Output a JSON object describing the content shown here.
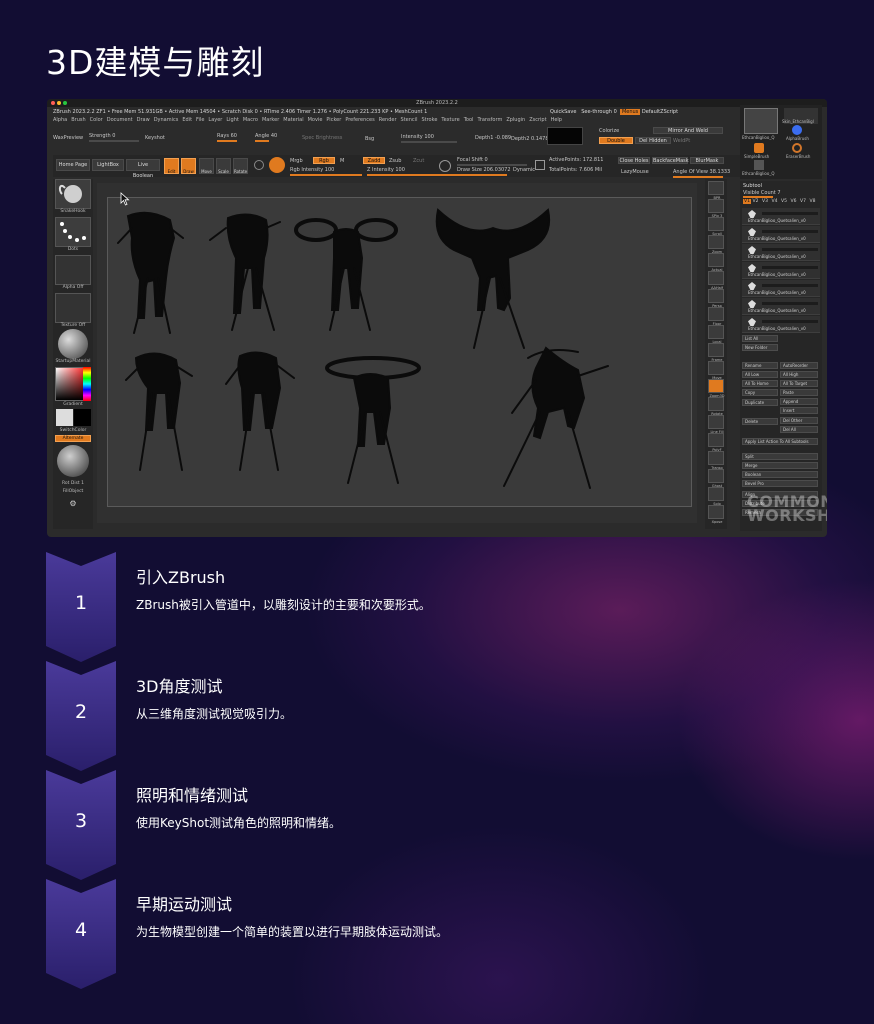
{
  "page": {
    "title": "3D建模与雕刻"
  },
  "zbrush": {
    "window_title": "ZBrush 2023.2.2",
    "info_line": "ZBrush 2023.2.2 ZF1  • Free Mem 51.931GB • Active Mem 14504 • Scratch Disk 0 • RTime 2.406 Timer 1.276 • PolyCount 221.233 KP • MeshCount 1",
    "quicksave": "QuickSave",
    "seethrough": "See-through 0",
    "menus_pill": "Menus",
    "default_zscript": "DefaultZScript",
    "menu_items": [
      "Alpha",
      "Brush",
      "Color",
      "Document",
      "Draw",
      "Dynamics",
      "Edit",
      "File",
      "Layer",
      "Light",
      "Macro",
      "Marker",
      "Material",
      "Movie",
      "Picker",
      "Preferences",
      "Render",
      "Stencil",
      "Stroke",
      "Texture",
      "Tool",
      "Transform",
      "Zplugin",
      "Zscript",
      "Help"
    ],
    "controls": {
      "wax_preview": "WaxPreview",
      "strength": "Strength 0",
      "keyshot": "Keyshot",
      "rays": "Rays 60",
      "angle": "Angle 40",
      "spec_brightness": "Spec Brightness",
      "bsg": "Bsg",
      "intensity": "Intensity 100",
      "depth1": "Depth1 -0.089",
      "depth2": "Depth2 0.1478",
      "colorize": "Colorize",
      "mirror_weld": "Mirror And Weld",
      "double": "Double",
      "del_hidden": "Del Hidden",
      "weld_pt": "WeldPt"
    },
    "toolbar": {
      "home_page": "Home Page",
      "lightbox": "LightBox",
      "live_boolean": "Live Boolean",
      "edit": "Edit",
      "draw": "Draw",
      "move": "Move",
      "scale": "Scale",
      "rotate": "Rotate",
      "mrgb": "Mrgb",
      "rgb": "Rgb",
      "m": "M",
      "rgb_intensity": "Rgb Intensity 100",
      "zadd": "Zadd",
      "zsub": "Zsub",
      "zcut": "Zcut",
      "z_intensity": "Z Intensity 100",
      "focal_shift": "Focal Shift 0",
      "draw_size": "Draw Size 206.03072",
      "dynamic": "Dynamic",
      "active_points": "ActivePoints: 172.811",
      "total_points": "TotalPoints: 7.606 Mil",
      "close_holes": "Close Holes",
      "backface_mask": "BackfaceMask",
      "blur_mask": "BlurMask",
      "lazy_mouse": "LazyMouse",
      "angle_of_view": "Angle Of View 38.1333"
    },
    "shelf": {
      "brush_label": "SnakeHook",
      "stroke_label": "Dots",
      "alpha_label": "Alpha Off",
      "texture_label": "Texture Off",
      "material_label": "StartupMaterial",
      "gradient_label": "Gradient",
      "switch_color": "SwitchColor",
      "alternate": "Alternate",
      "rot_dist": "Rot Dist 1",
      "fill_object": "FillObject"
    },
    "right_tools": [
      "BPR",
      "SPix 3",
      "Scroll",
      "Zoom",
      "Actual",
      "AAHalf",
      "Persp",
      "Floor",
      "Local",
      "Frame",
      "Move",
      "Zoom3D",
      "Rotate",
      "Line Fill",
      "PolyF",
      "Transp",
      "Ghost",
      "Solo",
      "Xpose"
    ],
    "brushes": {
      "b1": "EthcanBiglioo_Q",
      "b2": "Skin_EthcanBigl",
      "b3": "AlphaBrush",
      "b4": "SimpleBrush",
      "b5": "EraserBrush",
      "b6": "EthcanBiglioo_Q"
    },
    "subtool": {
      "header": "Subtool",
      "visible_count": "Visible Count 7",
      "versions": [
        "V1",
        "V2",
        "V3",
        "V4",
        "V5",
        "V6",
        "V7",
        "V8"
      ],
      "items": [
        "EthcanBiglioo_Quetsalien_v0",
        "EthcanBiglioo_Quetsalien_v0",
        "EthcanBiglioo_Quetsalien_v0",
        "EthcanBiglioo_Quetsalien_v0",
        "EthcanBiglioo_Quetsalien_v0",
        "EthcanBiglioo_Quetsalien_v0",
        "EthcanBiglioo_Quetsalien_v0"
      ],
      "list_all": "List All",
      "new_folder": "New Folder",
      "rename": "Rename",
      "auto_reorder": "AutoReorder",
      "all_low": "All Low",
      "all_high": "All High",
      "all_to_home": "All To Home",
      "all_to_target": "All To Target",
      "copy": "Copy",
      "paste": "Paste",
      "duplicate": "Duplicate",
      "append": "Append",
      "insert": "Insert",
      "delete": "Delete",
      "del_other": "Del Other",
      "del_all": "Del All",
      "apply_list": "Apply List Action To All Subtools",
      "split": "Split",
      "merge": "Merge",
      "boolean": "Boolean",
      "bevel_pro": "Bevel Pro",
      "align": "Align",
      "distribute": "Distribute",
      "remesh": "Remesh"
    },
    "watermark_line1": "COMMON",
    "watermark_line2": "WORKSHOP",
    "colors": {
      "accent": "#e07a1f",
      "panel": "#262626",
      "canvas": "#3a3a3a"
    }
  },
  "steps": [
    {
      "number": "1",
      "title": "引入ZBrush",
      "desc": "ZBrush被引入管道中，以雕刻设计的主要和次要形式。"
    },
    {
      "number": "2",
      "title": "3D角度测试",
      "desc": "从三维角度测试视觉吸引力。"
    },
    {
      "number": "3",
      "title": "照明和情绪测试",
      "desc": "使用KeyShot测试角色的照明和情绪。"
    },
    {
      "number": "4",
      "title": "早期运动测试",
      "desc": "为生物模型创建一个简单的装置以进行早期肢体运动测试。"
    }
  ],
  "colors": {
    "background": "#120d33",
    "chevron_top": "#4a3a9a",
    "chevron_bottom": "#2a1f6b"
  }
}
